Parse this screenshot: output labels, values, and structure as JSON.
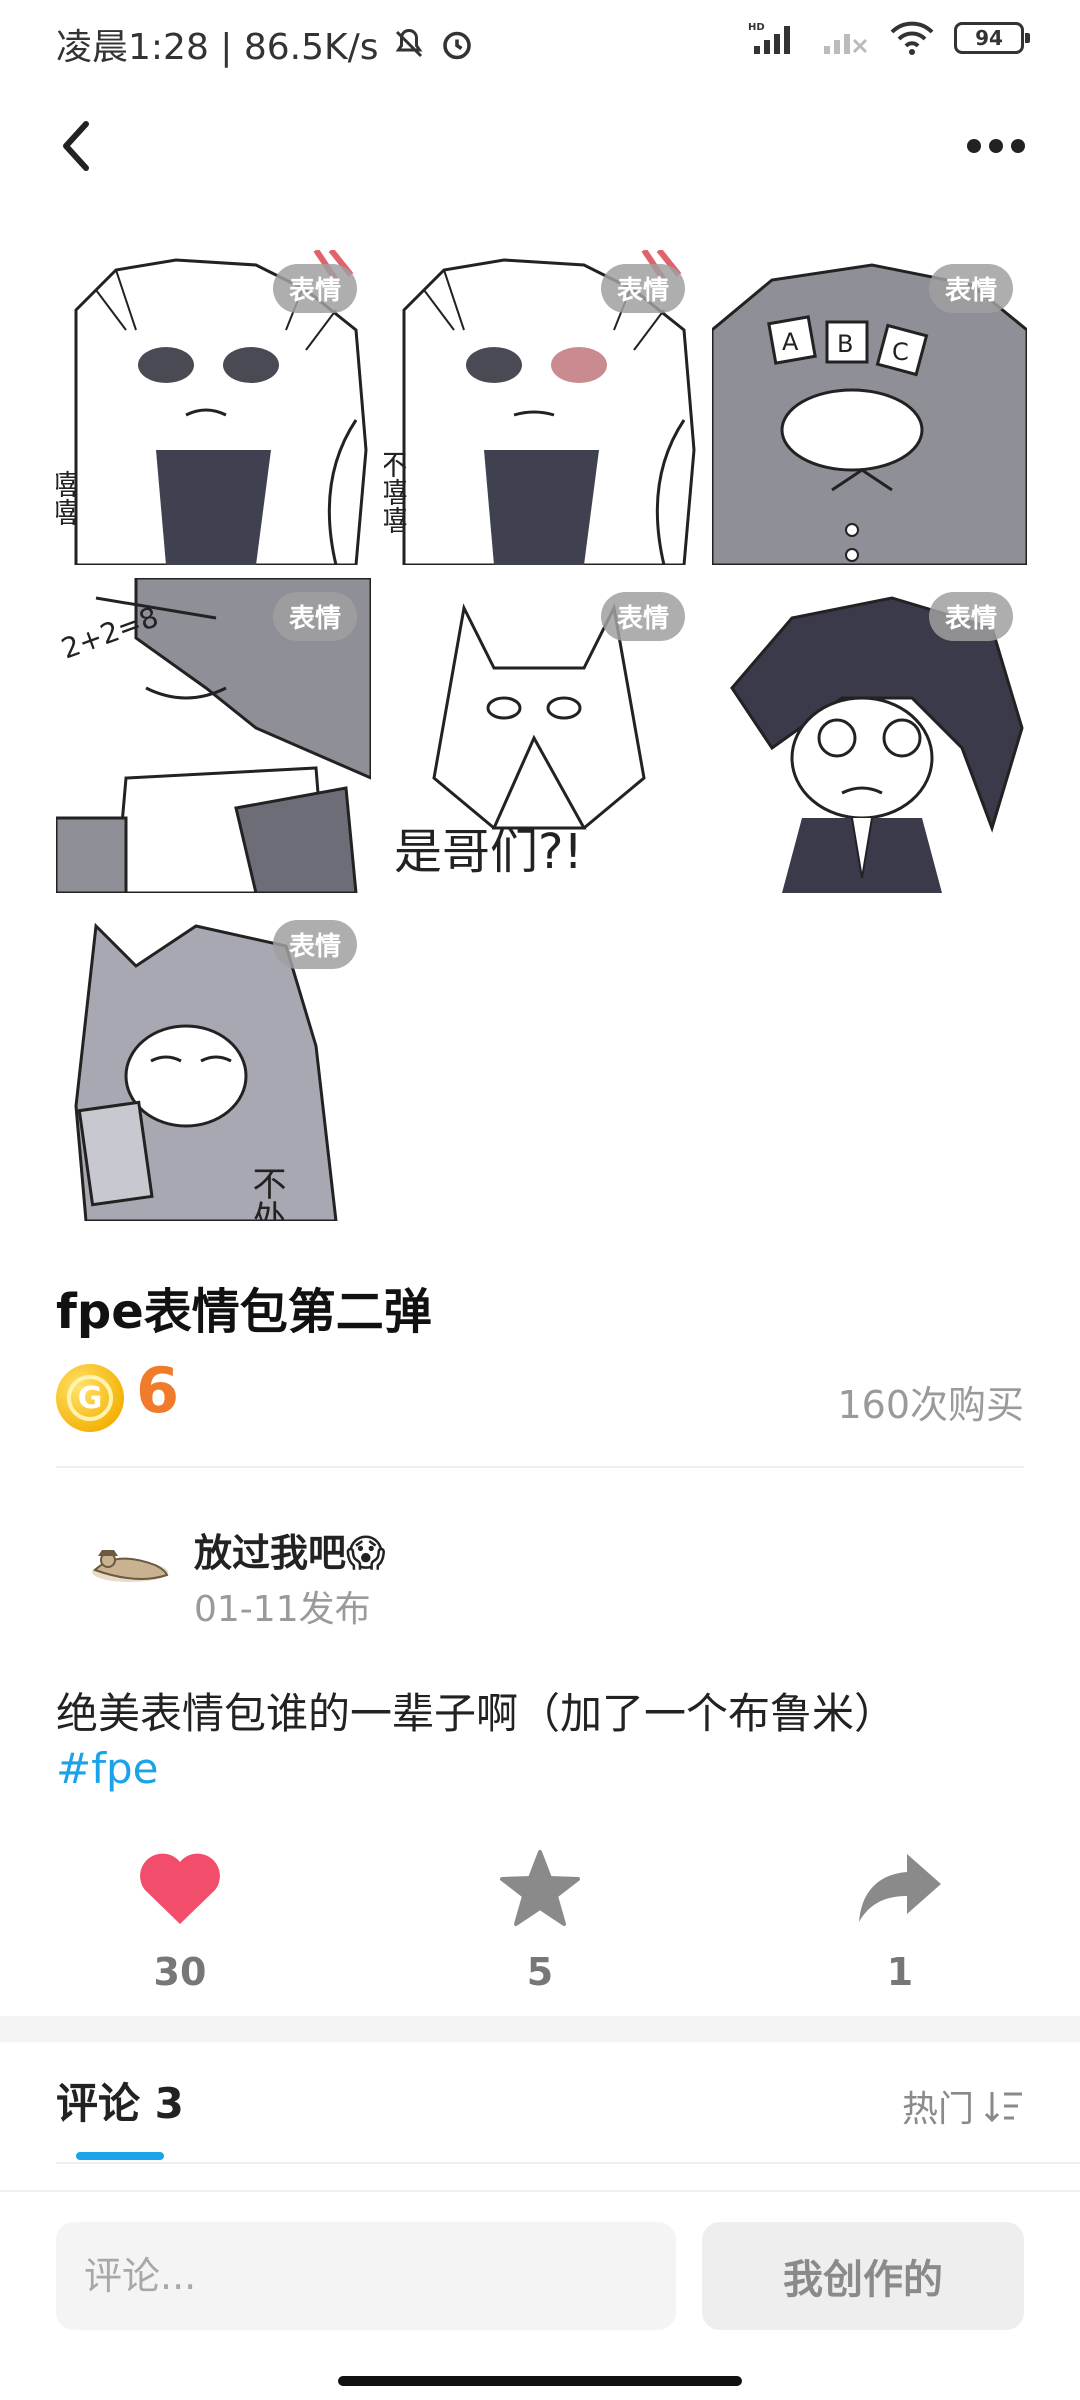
{
  "status_bar": {
    "time_text": "凌晨1:28 | 86.5K/s",
    "battery_level": "94"
  },
  "stickers": [
    {
      "badge": "表情",
      "caption": "嘻嘻"
    },
    {
      "badge": "表情",
      "caption": "不嘻嘻"
    },
    {
      "badge": "表情",
      "caption": ""
    },
    {
      "badge": "表情",
      "caption": "2+2=8"
    },
    {
      "badge": "表情",
      "caption": "是哥们?!"
    },
    {
      "badge": "表情",
      "caption": ""
    },
    {
      "badge": "表情",
      "caption": "不处"
    }
  ],
  "product": {
    "title": "fpe表情包第二弹",
    "coin_symbol": "G",
    "price": "6",
    "purchases": "160次购买"
  },
  "author": {
    "name": "放过我吧😱",
    "date": "01-11发布"
  },
  "post": {
    "text": "绝美表情包谁的一辈子啊（加了一个布鲁米）",
    "hashtag": "#fpe"
  },
  "actions": {
    "like_count": "30",
    "favorite_count": "5",
    "share_count": "1",
    "like_color": "#f24e6b",
    "icon_color": "#8a8a8a"
  },
  "comments": {
    "tab_label": "评论 3",
    "sort_label": "热门"
  },
  "bottom_bar": {
    "input_placeholder": "评论...",
    "my_creations_label": "我创作的"
  },
  "colors": {
    "accent": "#1aa3e8",
    "price": "#f07b2a"
  }
}
